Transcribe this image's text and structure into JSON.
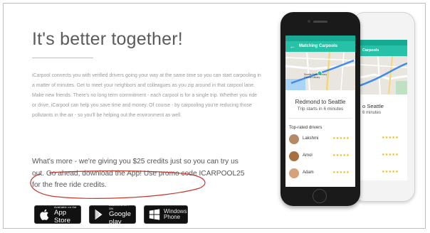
{
  "page": {
    "headline": "It's better together!",
    "intro": "iCarpool connects you with verified drivers going your way at the same time so you can start carpooling in a matter of minutes. Get to meet your neighbors and colleagues as you zip around in that carpool lane. Make new friends. There's no long term commitment - each carpool is for a single trip. Whether you ride or drive, iCarpool can help you save time and money. Of course - by carpooling you're reducing those pollutants in the air - so you'll be helping out the environment as well.",
    "promo": "What's more - we're giving you $25 credits just so you can try us out. Go ahead, download the App! Use promo code ICARPOOL25 for the free ride credits."
  },
  "badges": {
    "app_store": {
      "small": "Available on the",
      "big": "App Store"
    },
    "google_play": {
      "small": "ANDROID APP ON",
      "big": "Google play"
    },
    "windows": {
      "line1": "Windows",
      "line2": "Phone"
    }
  },
  "phone": {
    "app_title": "Matching Carpools",
    "back_title": "Carpools",
    "map_label": "Seattle Public Library Central Library",
    "route_title": "Redmond to Seattle",
    "route_sub": "Trip starts in 6 minutes",
    "back_route_title": "o Seattle",
    "back_route_sub": "6 minutes",
    "drivers_header": "Top-rated drivers",
    "drivers": [
      {
        "name": "Lakshmi",
        "stars": "★★★★★"
      },
      {
        "name": "Amol",
        "stars": "★★★★★"
      },
      {
        "name": "Adam",
        "stars": "★★★★★"
      }
    ]
  },
  "colors": {
    "accent": "#26c1a6",
    "accent_dark": "#17a992",
    "stars": "#f0b400",
    "annotation": "#c0392b"
  }
}
